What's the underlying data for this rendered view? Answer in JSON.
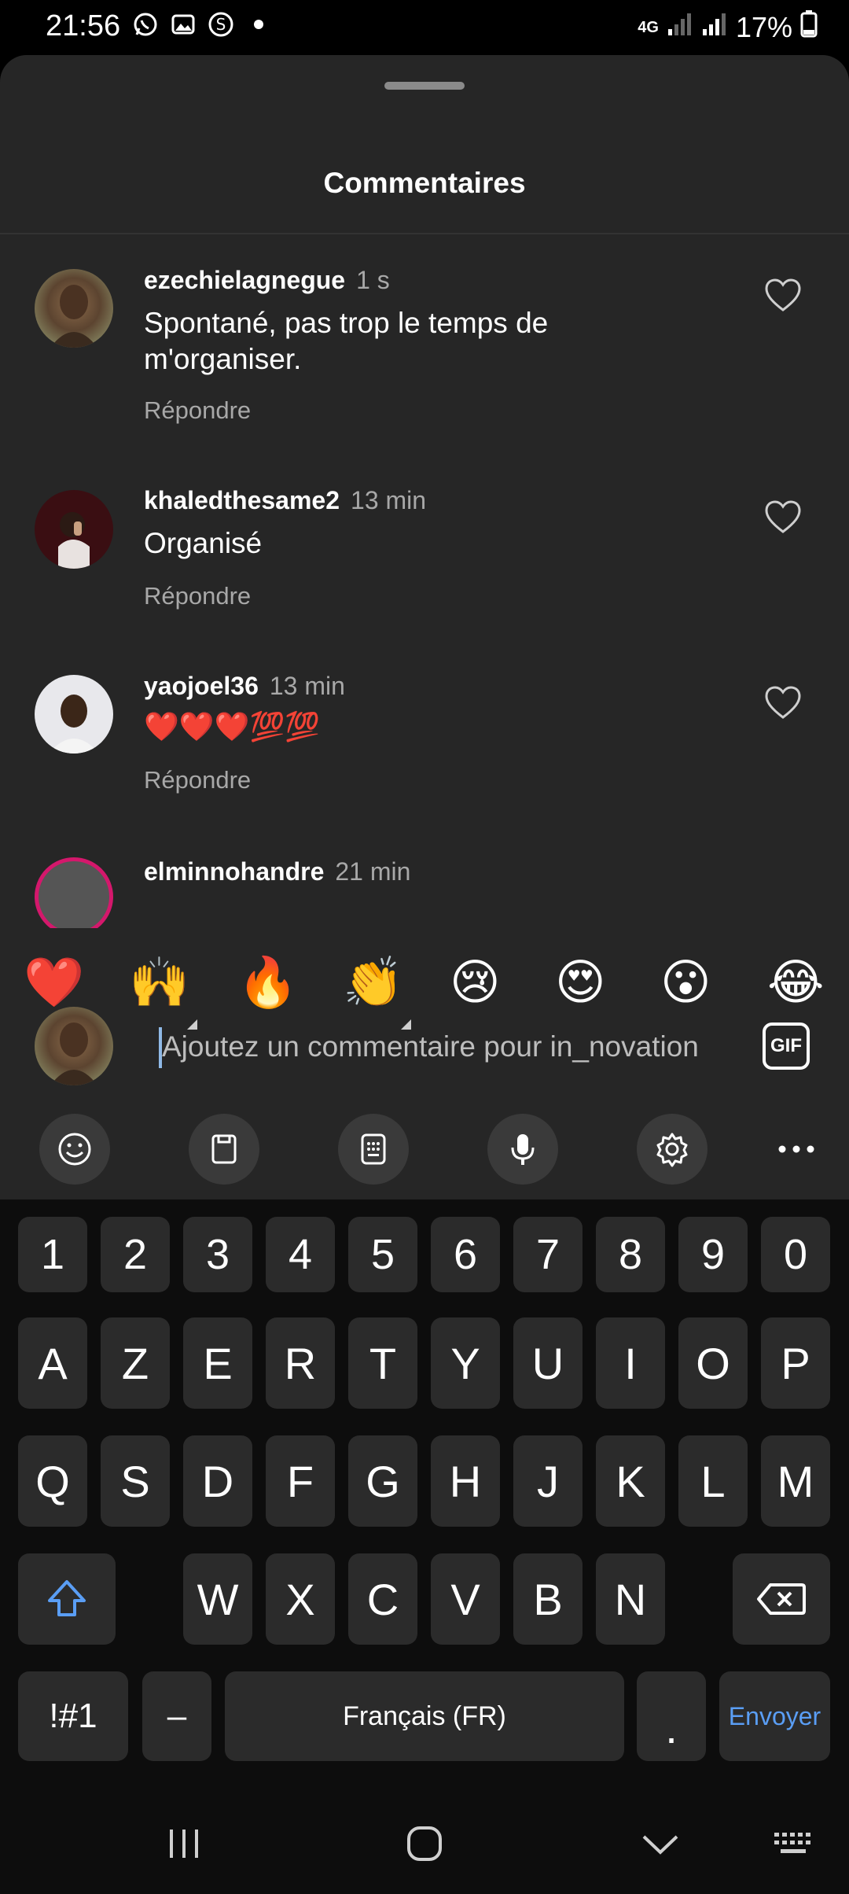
{
  "status_bar": {
    "time": "21:56",
    "network": "4G",
    "battery": "17%",
    "icons": [
      "whatsapp-icon",
      "gallery-icon",
      "shazam-icon",
      "dot-icon",
      "signal-icon",
      "signal-icon",
      "battery-icon"
    ]
  },
  "sheet": {
    "title": "Commentaires"
  },
  "comments": [
    {
      "username": "ezechielagnegue",
      "time": "1 s",
      "text": "Spontané, pas trop le temps de m'organiser.",
      "reply": "Répondre"
    },
    {
      "username": "khaledthesame2",
      "time": "13 min",
      "text": "Organisé",
      "reply": "Répondre"
    },
    {
      "username": "yaojoel36",
      "time": "13 min",
      "text": "❤️❤️❤️💯💯",
      "reply": "Répondre"
    },
    {
      "username": "elminnohandre",
      "time": "21 min"
    }
  ],
  "quick_emojis": [
    "❤️",
    "🙌",
    "🔥",
    "👏",
    "😢",
    "😍",
    "😮",
    "😂"
  ],
  "comment_input": {
    "placeholder": "Ajoutez un commentaire pour in_novation",
    "gif_label": "GIF"
  },
  "keyboard_toolbar": [
    "emoji-icon",
    "clipboard-icon",
    "keypad-icon",
    "microphone-icon",
    "settings-icon",
    "more-icon"
  ],
  "keyboard": {
    "numbers": [
      "1",
      "2",
      "3",
      "4",
      "5",
      "6",
      "7",
      "8",
      "9",
      "0"
    ],
    "row1": [
      "A",
      "Z",
      "E",
      "R",
      "T",
      "Y",
      "U",
      "I",
      "O",
      "P"
    ],
    "row2": [
      "Q",
      "S",
      "D",
      "F",
      "G",
      "H",
      "J",
      "K",
      "L",
      "M"
    ],
    "row3": [
      "W",
      "X",
      "C",
      "V",
      "B",
      "N"
    ],
    "symbols_label": "!#1",
    "dash_label": "–",
    "space_label": "Français (FR)",
    "period_label": ".",
    "enter_label": "Envoyer"
  },
  "colors": {
    "sheet_bg": "#262626",
    "key_bg": "#2b2b2b",
    "accent_blue": "#5a9ef5",
    "secondary_text": "#a8a8a8"
  }
}
